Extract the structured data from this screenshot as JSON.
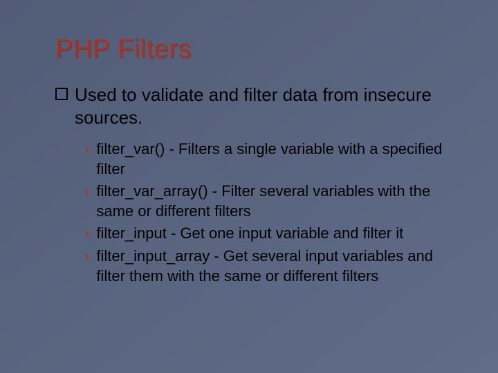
{
  "title": "PHP Filters",
  "main_point": "Used to validate and filter data from insecure sources.",
  "sub_items": [
    "filter_var() - Filters a single variable with a specified filter",
    "filter_var_array() - Filter several variables with the same or different filters",
    "filter_input - Get one input variable and filter it",
    "filter_input_array - Get several input variables and filter them with the same or different filters"
  ]
}
